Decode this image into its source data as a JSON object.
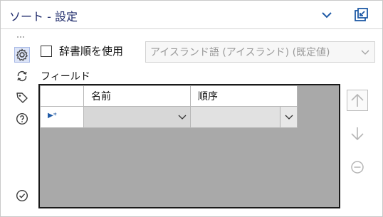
{
  "header": {
    "title": "ソート - 設定",
    "collapse_icon": "chevron-down-icon",
    "dock_icon": "dock-window-icon"
  },
  "toolbar": {
    "items": [
      {
        "name": "settings",
        "icon": "gear-icon",
        "active": true
      },
      {
        "name": "cycle",
        "icon": "cycle-icon"
      },
      {
        "name": "annotation",
        "icon": "tag-icon"
      },
      {
        "name": "help",
        "icon": "help-icon"
      },
      {
        "name": "ok",
        "icon": "checkmark-icon"
      }
    ]
  },
  "options": {
    "dictionary_order_label": "辞書順を使用",
    "dictionary_order_checked": false,
    "language_value": "アイスランド語 (アイスランド) (既定値)"
  },
  "fields": {
    "section_label": "フィールド",
    "columns": [
      "",
      "名前",
      "順序"
    ],
    "new_row_marker": "▶*",
    "rows": [
      {
        "name": "",
        "order": ""
      }
    ]
  },
  "colors": {
    "title": "#1f2b6b",
    "accent": "#1f5aa6",
    "grid_background": "#a9a9a9",
    "disabled_text": "#9a9a9a"
  }
}
